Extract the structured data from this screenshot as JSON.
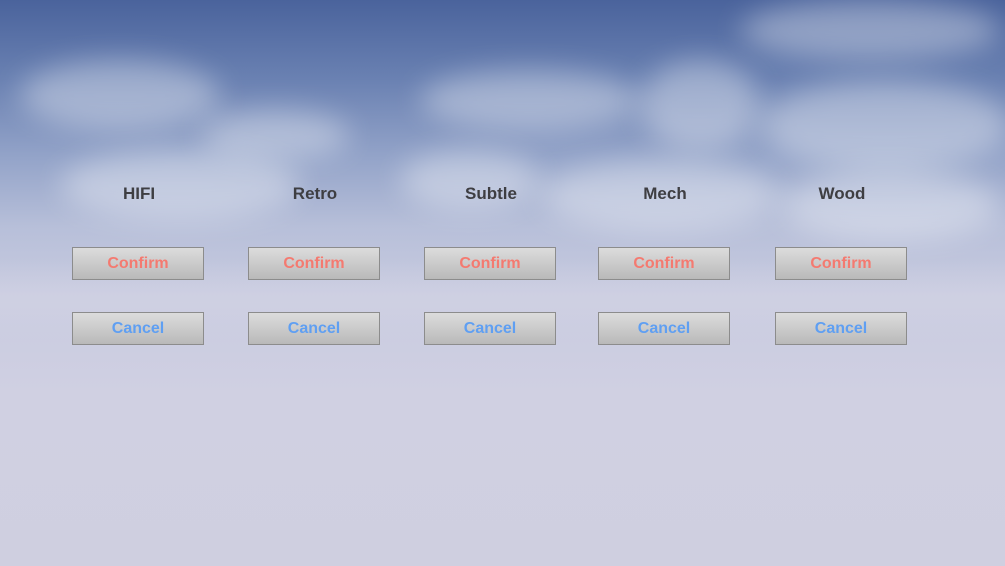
{
  "colors": {
    "confirm_text": "#f47a70",
    "cancel_text": "#5f9ff2",
    "title_text": "#3e3e42"
  },
  "themes": [
    {
      "title": "HIFI",
      "confirm_label": "Confirm",
      "cancel_label": "Cancel"
    },
    {
      "title": "Retro",
      "confirm_label": "Confirm",
      "cancel_label": "Cancel"
    },
    {
      "title": "Subtle",
      "confirm_label": "Confirm",
      "cancel_label": "Cancel"
    },
    {
      "title": "Mech",
      "confirm_label": "Confirm",
      "cancel_label": "Cancel"
    },
    {
      "title": "Wood",
      "confirm_label": "Confirm",
      "cancel_label": "Cancel"
    }
  ]
}
